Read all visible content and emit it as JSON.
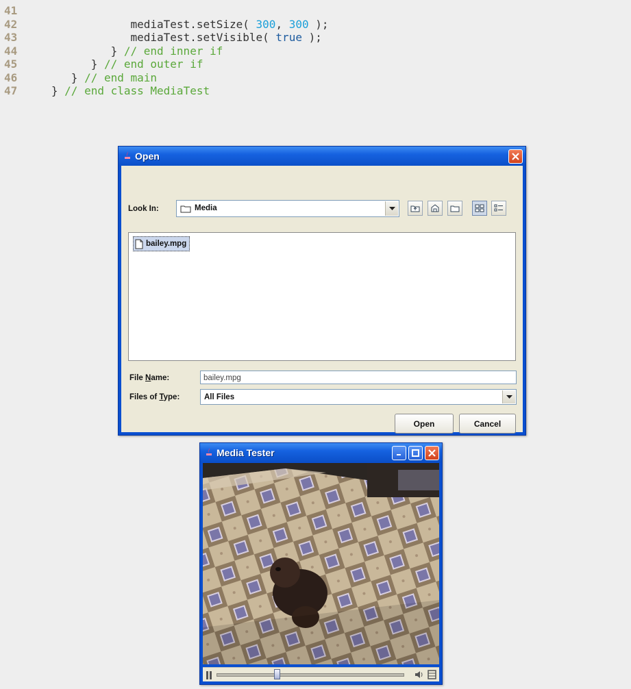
{
  "code_lines": [
    {
      "num": "41",
      "indent": "",
      "parts": []
    },
    {
      "num": "42",
      "indent": "               ",
      "parts": [
        {
          "t": "mediaTest.setSize( ",
          "c": "plain"
        },
        {
          "t": "300",
          "c": "num"
        },
        {
          "t": ", ",
          "c": "plain"
        },
        {
          "t": "300",
          "c": "num"
        },
        {
          "t": " );",
          "c": "plain"
        }
      ]
    },
    {
      "num": "43",
      "indent": "               ",
      "parts": [
        {
          "t": "mediaTest.setVisible( ",
          "c": "plain"
        },
        {
          "t": "true",
          "c": "kw"
        },
        {
          "t": " );",
          "c": "plain"
        }
      ]
    },
    {
      "num": "44",
      "indent": "            ",
      "parts": [
        {
          "t": "} ",
          "c": "plain"
        },
        {
          "t": "// end inner if",
          "c": "cm"
        }
      ]
    },
    {
      "num": "45",
      "indent": "         ",
      "parts": [
        {
          "t": "} ",
          "c": "plain"
        },
        {
          "t": "// end outer if",
          "c": "cm"
        }
      ]
    },
    {
      "num": "46",
      "indent": "      ",
      "parts": [
        {
          "t": "} ",
          "c": "plain"
        },
        {
          "t": "// end main",
          "c": "cm"
        }
      ]
    },
    {
      "num": "47",
      "indent": "   ",
      "parts": [
        {
          "t": "} ",
          "c": "plain"
        },
        {
          "t": "// end class MediaTest",
          "c": "cm"
        }
      ]
    }
  ],
  "open_dialog": {
    "title": "Open",
    "look_in_label": "Look In:",
    "look_in_value": "Media",
    "files": [
      "bailey.mpg"
    ],
    "file_name_label": "File Name:",
    "file_name_value": "bailey.mpg",
    "files_of_type_label": "Files of Type:",
    "files_of_type_value": "All Files",
    "open_button": "Open",
    "cancel_button": "Cancel"
  },
  "media_window": {
    "title": "Media Tester",
    "playback_position": 0.32
  },
  "colors": {
    "title_bar": "#0b4fc8",
    "dialog_bg": "#ece9d8",
    "code_number": "#1a9fd9",
    "code_keyword": "#1c5a9e",
    "code_comment": "#5aa83a",
    "line_number": "#a89a80"
  }
}
